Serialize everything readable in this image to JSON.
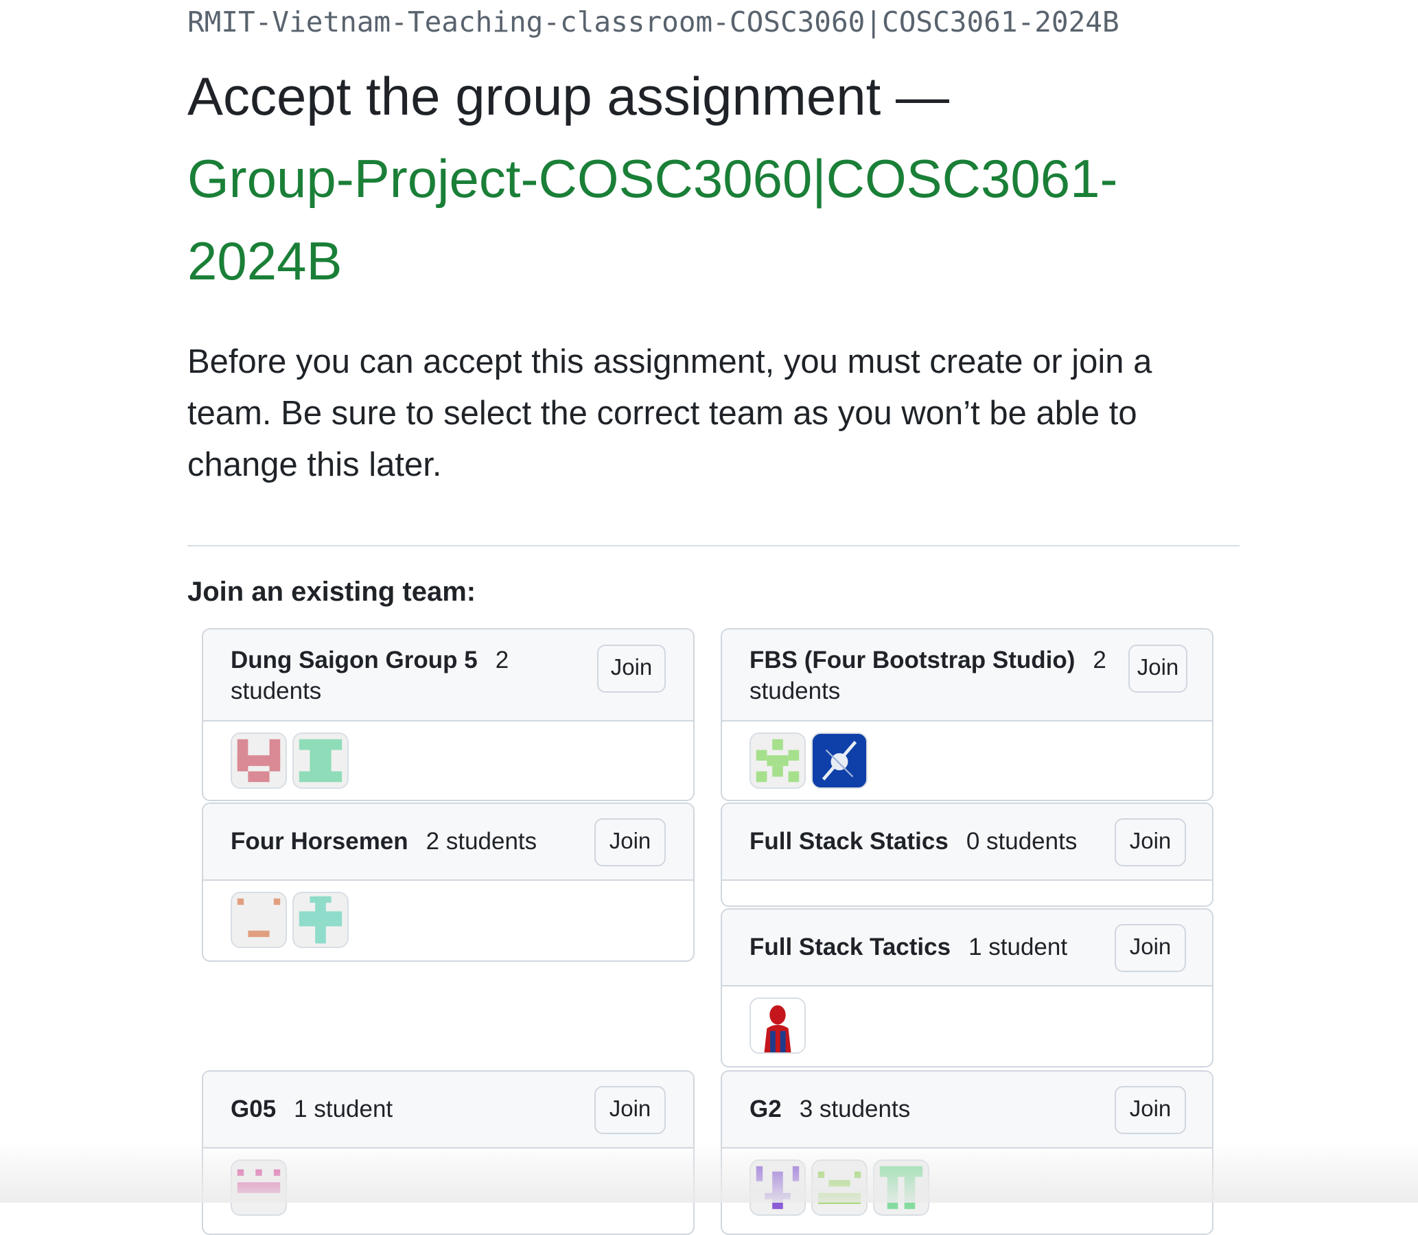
{
  "page": {
    "org_name": "RMIT-Vietnam-Teaching-classroom-COSC3060|COSC3061-2024B",
    "title_prefix": "Accept the group assignment —",
    "assignment_name": "Group-Project-COSC3060|COSC3061-2024B",
    "intro": "Before you can accept this assignment, you must create or join a team. Be sure to select the correct team as you won’t be able to change this later.",
    "join_heading": "Join an existing team:"
  },
  "teams": [
    {
      "name": "Dung Saigon Group 5",
      "count": "2 students",
      "join_label": "Join",
      "avatars": [
        "identicon-red",
        "identicon-mint"
      ]
    },
    {
      "name": "FBS (Four Bootstrap Studio)",
      "count": "2 students",
      "join_label": "Join",
      "avatars": [
        "identicon-green",
        "photo-blue-logo"
      ]
    },
    {
      "name": "Four Horsemen",
      "count": "2 students",
      "join_label": "Join",
      "avatars": [
        "identicon-orange",
        "identicon-teal"
      ]
    },
    {
      "name": "Full Stack Statics",
      "count": "0 students",
      "join_label": "Join",
      "avatars": []
    },
    {
      "name": "Full Stack Tactics",
      "count": "1 student",
      "join_label": "Join",
      "avatars": [
        "photo-spiderman"
      ]
    },
    {
      "name": "G05",
      "count": "1 student",
      "join_label": "Join",
      "avatars": [
        "identicon-pink"
      ]
    },
    {
      "name": "G2",
      "count": "3 students",
      "join_label": "Join",
      "avatars": [
        "identicon-purple",
        "identicon-lime",
        "identicon-green2"
      ]
    }
  ],
  "colors": {
    "link_green": "#1a7f37",
    "border": "#d0d7de",
    "header_bg": "#f6f8fa"
  }
}
